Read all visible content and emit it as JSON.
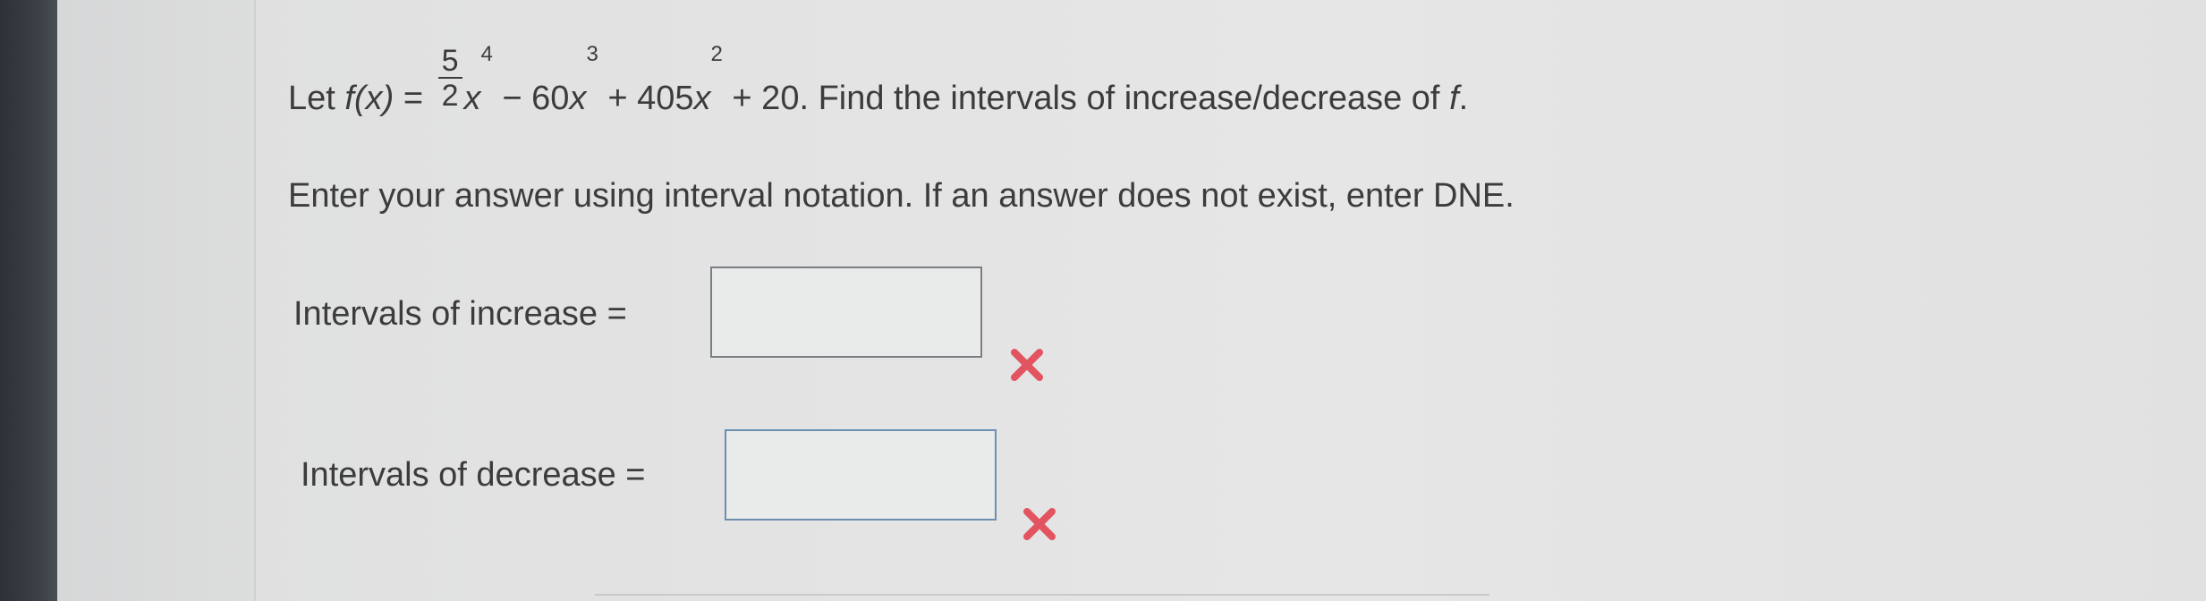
{
  "question": {
    "prefix": "Let ",
    "f_of_x": "f(x)",
    "equals": " = ",
    "frac_num": "5",
    "frac_den": "2",
    "x4": "x",
    "exp4": "4",
    "mid1": " − 60",
    "x3": "x",
    "exp3": "3",
    "mid2": " + 405",
    "x2": "x",
    "exp2": "2",
    "suffix": " + 20. Find the intervals of increase/decrease of ",
    "f": "f",
    "period": "."
  },
  "instruction": "Enter your answer using interval notation. If an answer does not exist, enter DNE.",
  "increase": {
    "label": "Intervals of increase =",
    "value": "",
    "status": "incorrect"
  },
  "decrease": {
    "label": "Intervals of decrease =",
    "value": "",
    "status": "incorrect"
  },
  "colors": {
    "incorrect_mark": "#e2545f",
    "text": "#3c3c3c"
  },
  "icons": {
    "incorrect": "x-mark-icon"
  }
}
